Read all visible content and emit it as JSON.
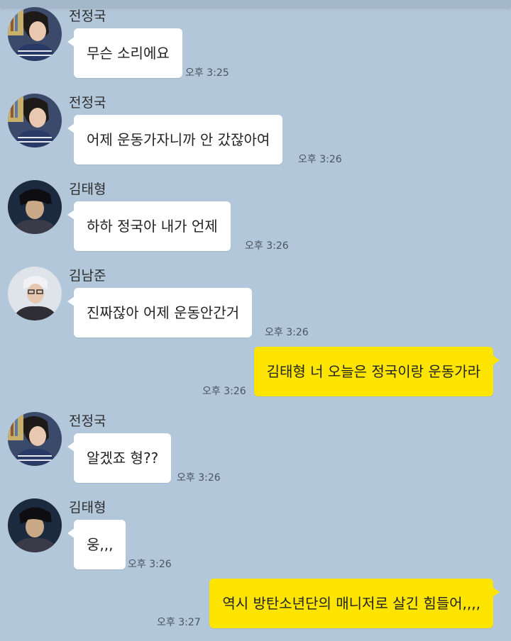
{
  "colors": {
    "background": "#b2c7d9",
    "incoming_bubble": "#ffffff",
    "outgoing_bubble": "#fee500"
  },
  "messages": [
    {
      "type": "incoming",
      "sender": "전정국",
      "avatar": "jungkook-avatar",
      "text": "무슨 소리에요",
      "time": "오후 3:25"
    },
    {
      "type": "incoming",
      "sender": "전정국",
      "avatar": "jungkook-avatar",
      "text": "어제 운동가자니까 안 갔잖아여",
      "time": "오후 3:26"
    },
    {
      "type": "incoming",
      "sender": "김태형",
      "avatar": "taehyung-avatar",
      "text": "하하 정국아 내가 언제",
      "time": "오후 3:26"
    },
    {
      "type": "incoming",
      "sender": "김남준",
      "avatar": "namjoon-avatar",
      "text": "진짜잖아 어제 운동안간거",
      "time": "오후 3:26"
    },
    {
      "type": "outgoing",
      "text": "김태형 너 오늘은 정국이랑 운동가라",
      "time": "오후 3:26"
    },
    {
      "type": "incoming",
      "sender": "전정국",
      "avatar": "jungkook-avatar",
      "text": "알겠죠 형??",
      "time": "오후 3:26"
    },
    {
      "type": "incoming",
      "sender": "김태형",
      "avatar": "taehyung-avatar",
      "text": "웅,,,",
      "time": "오후 3:26"
    },
    {
      "type": "outgoing",
      "text": "역시 방탄소년단의 매니저로 살긴 힘들어,,,,",
      "time": "오후 3:27"
    }
  ]
}
